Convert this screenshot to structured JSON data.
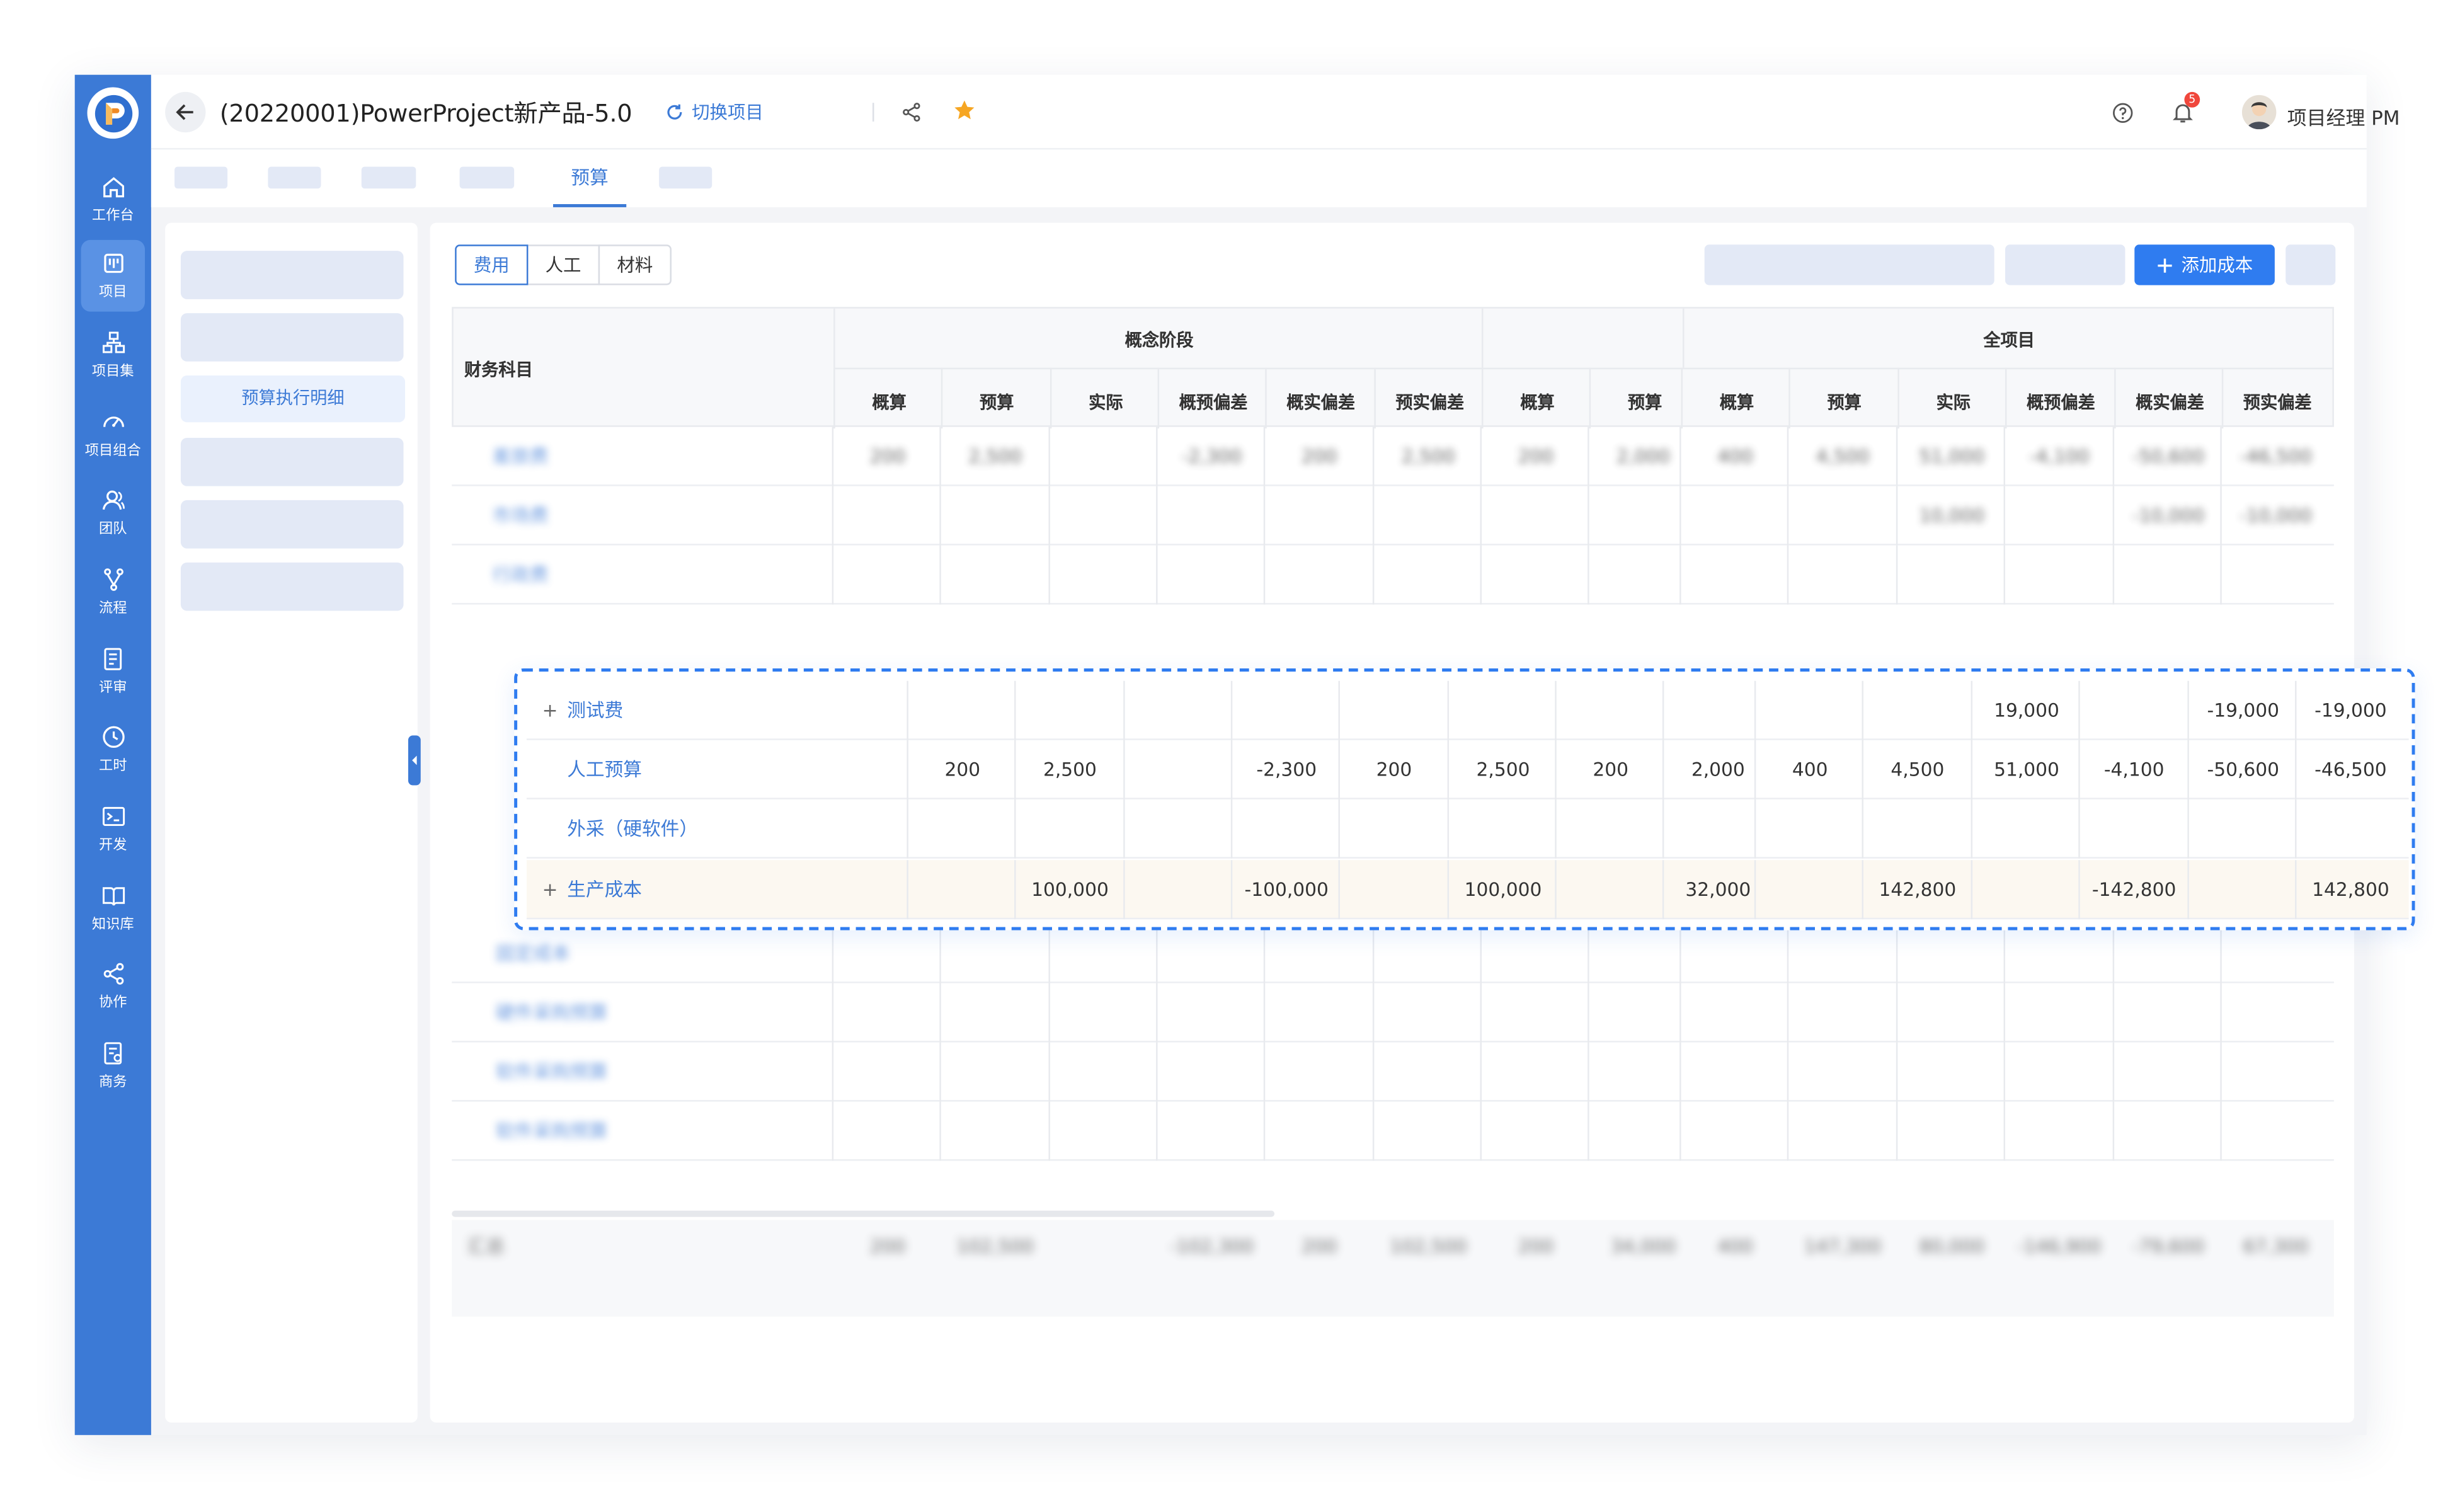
{
  "app": {
    "project_title": "(20220001)PowerProject新产品-5.0",
    "switch_project": "切换项目",
    "user": "项目经理 PM",
    "notification_count": "5",
    "accent": "#3c7ad6"
  },
  "sidebar": {
    "items": [
      {
        "label": "工作台",
        "icon": "home-icon"
      },
      {
        "label": "项目",
        "icon": "project-icon"
      },
      {
        "label": "项目集",
        "icon": "program-icon"
      },
      {
        "label": "项目组合",
        "icon": "dashboard-icon"
      },
      {
        "label": "团队",
        "icon": "team-icon"
      },
      {
        "label": "流程",
        "icon": "flow-icon"
      },
      {
        "label": "评审",
        "icon": "review-icon"
      },
      {
        "label": "工时",
        "icon": "clock-icon"
      },
      {
        "label": "开发",
        "icon": "terminal-icon"
      },
      {
        "label": "知识库",
        "icon": "book-icon"
      },
      {
        "label": "协作",
        "icon": "share-icon"
      },
      {
        "label": "商务",
        "icon": "business-icon"
      }
    ]
  },
  "tabs": {
    "active": "预算"
  },
  "left_panel": {
    "active_item": "预算执行明细"
  },
  "toolbar": {
    "segments": [
      "费用",
      "人工",
      "材料"
    ],
    "add_cost": "添加成本"
  },
  "table": {
    "subject_header": "财务科目",
    "group_concept": "概念阶段",
    "group_all": "全项目",
    "columns": [
      "概算",
      "预算",
      "实际",
      "概预偏差",
      "概实偏差",
      "预实偏差",
      "概算",
      "预算",
      "概算",
      "预算",
      "实际",
      "概预偏差",
      "概实偏差",
      "预实偏差"
    ],
    "blurred_rows": [
      {
        "name": "差旅费",
        "values": [
          "200",
          "2,500",
          "",
          "-2,300",
          "200",
          "2,500",
          "200",
          "2,000",
          "400",
          "4,500",
          "51,000",
          "-4,100",
          "-50,600",
          "-46,500"
        ]
      },
      {
        "name": "市场费",
        "values": [
          "",
          "",
          "",
          "",
          "",
          "",
          "",
          "",
          "",
          "",
          "10,000",
          "",
          "-10,000",
          "-10,000"
        ]
      },
      {
        "name": "行政费",
        "values": [
          "",
          "",
          "",
          "",
          "",
          "",
          "",
          "",
          "",
          "",
          "",
          "",
          "",
          ""
        ]
      }
    ],
    "rows": [
      {
        "name": "测试费",
        "expand": "+",
        "values": [
          "",
          "",
          "",
          "",
          "",
          "",
          "",
          "",
          "",
          "",
          "19,000",
          "",
          "-19,000",
          "-19,000"
        ]
      },
      {
        "name": "人工预算",
        "expand": "",
        "values": [
          "200",
          "2,500",
          "",
          "-2,300",
          "200",
          "2,500",
          "200",
          "2,000",
          "400",
          "4,500",
          "51,000",
          "-4,100",
          "-50,600",
          "-46,500"
        ]
      },
      {
        "name": "外采（硬软件）",
        "expand": "",
        "values": [
          "",
          "",
          "",
          "",
          "",
          "",
          "",
          "",
          "",
          "",
          "",
          "",
          "",
          ""
        ]
      },
      {
        "name": "生产成本",
        "expand": "+",
        "values": [
          "",
          "100,000",
          "",
          "-100,000",
          "",
          "100,000",
          "",
          "32,000",
          "",
          "142,800",
          "",
          "-142,800",
          "",
          "142,800"
        ]
      }
    ],
    "blurred_rows_below": [
      "固定成本",
      "硬件采购预算",
      "软件采购预算",
      "软件采购预算"
    ],
    "summary": {
      "label": "汇总",
      "values": [
        "200",
        "102,500",
        "",
        "-102,300",
        "200",
        "102,500",
        "200",
        "34,000",
        "400",
        "147,300",
        "80,000",
        "-146,900",
        "-79,600",
        "67,300"
      ]
    }
  }
}
